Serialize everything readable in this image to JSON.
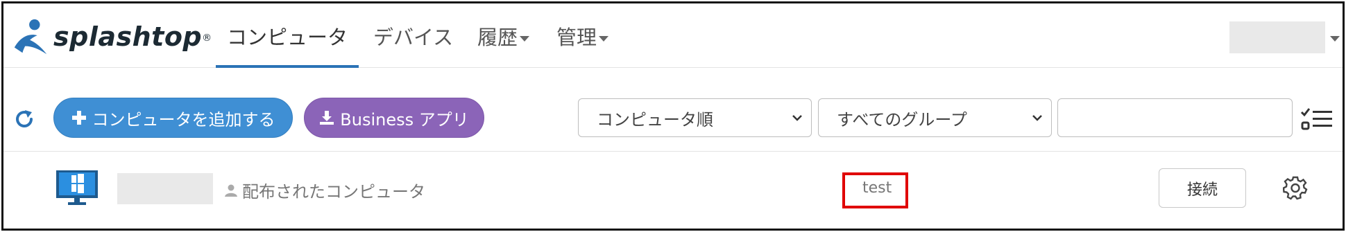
{
  "brand": {
    "name": "splashtop",
    "mark": "®"
  },
  "nav": {
    "computers": "コンピュータ",
    "devices": "デバイス",
    "history": "履歴",
    "admin": "管理"
  },
  "toolbar": {
    "add_computer": "コンピュータを追加する",
    "business_app": "Business アプリ",
    "sort_selected": "コンピュータ順",
    "group_selected": "すべてのグループ",
    "search_value": ""
  },
  "computers": [
    {
      "name": "",
      "distribution": "配布されたコンピュータ",
      "tag": "test",
      "connect_label": "接続"
    }
  ],
  "colors": {
    "accent_blue": "#2b73b6",
    "add_button": "#3f8fd4",
    "business_button": "#8b64b8",
    "highlight_red": "#e00000"
  },
  "icons": [
    "refresh-icon",
    "plus-icon",
    "download-icon",
    "chevron-down-icon",
    "list-filter-icon",
    "windows-monitor-icon",
    "person-icon",
    "gear-icon"
  ]
}
